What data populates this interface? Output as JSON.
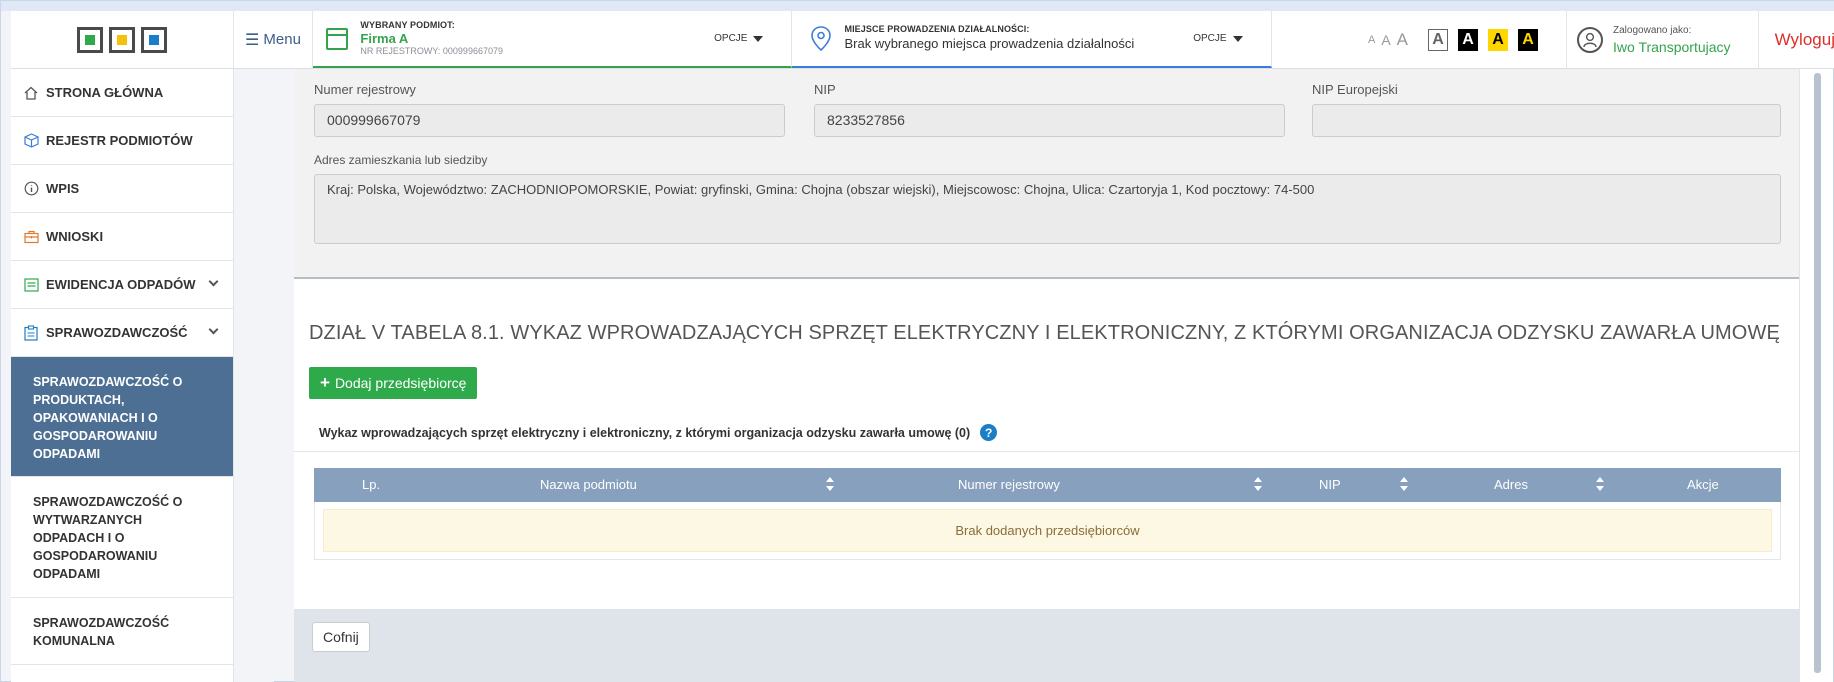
{
  "header": {
    "menu_label": "Menu",
    "podmiot_label": "WYBRANY PODMIOT:",
    "podmiot_name": "Firma A",
    "podmiot_nr": "NR REJESTROWY: 000999667079",
    "opcje_label": "OPCJE",
    "miejsce_label": "MIEJSCE PROWADZENIA DZIAŁALNOŚCI:",
    "miejsce_value": "Brak wybranego miejsca prowadzenia działalności",
    "opcje_label_2": "OPCJE",
    "font_sizes": [
      "A",
      "A",
      "A"
    ],
    "contrast_options": [
      "A",
      "A",
      "A",
      "A"
    ],
    "logged_as_label": "Zalogowano jako:",
    "user_name": "Iwo Transportujacy",
    "logout_label": "Wyloguj"
  },
  "sidebar": {
    "items": [
      {
        "label": "STRONA GŁÓWNA",
        "icon": "home-icon"
      },
      {
        "label": "REJESTR PODMIOTÓW",
        "icon": "cube-icon"
      },
      {
        "label": "WPIS",
        "icon": "info-icon"
      },
      {
        "label": "WNIOSKI",
        "icon": "briefcase-icon"
      },
      {
        "label": "EWIDENCJA ODPADÓW",
        "icon": "list-icon"
      },
      {
        "label": "SPRAWOZDAWCZOŚĆ",
        "icon": "clipboard-icon"
      }
    ],
    "sub_items": [
      {
        "label": "SPRAWOZDAWCZOŚĆ O PRODUKTACH, OPAKOWANIACH I O GOSPODAROWANIU ODPADAMI"
      },
      {
        "label": "SPRAWOZDAWCZOŚĆ O WYTWARZANYCH ODPADACH I O GOSPODAROWANIU ODPADAMI"
      },
      {
        "label": "SPRAWOZDAWCZOŚĆ KOMUNALNA"
      }
    ]
  },
  "form": {
    "numer_label": "Numer rejestrowy",
    "numer_value": "000999667079",
    "nip_label": "NIP",
    "nip_value": "8233527856",
    "nip_eu_label": "NIP Europejski",
    "nip_eu_value": "",
    "adres_label": "Adres zamieszkania lub siedziby",
    "adres_value": "Kraj: Polska, Województwo: ZACHODNIOPOMORSKIE, Powiat: gryfinski, Gmina: Chojna (obszar wiejski), Miejscowosc: Chojna, Ulica: Czartoryja 1, Kod pocztowy: 74-500"
  },
  "section": {
    "title": "DZIAŁ V TABELA 8.1. WYKAZ WPROWADZAJĄCYCH SPRZĘT ELEKTRYCZNY I ELEKTRONICZNY, Z KTÓRYMI ORGANIZACJA ODZYSKU ZAWARŁA UMOWĘ",
    "add_button": "Dodaj przedsiębiorcę",
    "list_caption": "Wykaz wprowadzających sprzęt elektryczny i elektroniczny, z którymi organizacja odzysku zawarła umowę (0)"
  },
  "table": {
    "columns": [
      "Lp.",
      "Nazwa podmiotu",
      "Numer rejestrowy",
      "NIP",
      "Adres",
      "Akcje"
    ],
    "empty_message": "Brak dodanych przedsiębiorców"
  },
  "footer": {
    "back_button": "Cofnij"
  },
  "colors": {
    "accent_green": "#2eaa4b",
    "sidebar_active": "#4e6f94",
    "table_header": "#86a0bd",
    "logout_red": "#d9302c"
  }
}
